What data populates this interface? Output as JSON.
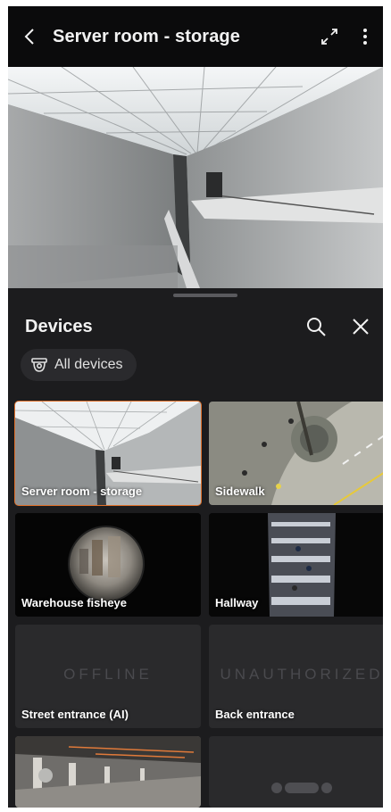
{
  "header": {
    "title": "Server room - storage"
  },
  "sheet": {
    "title": "Devices",
    "filter_chip": "All devices"
  },
  "devices": [
    {
      "name": "Server room - storage",
      "selected": true,
      "status": ""
    },
    {
      "name": "Sidewalk",
      "selected": false,
      "status": ""
    },
    {
      "name": "Warehouse fisheye",
      "selected": false,
      "status": ""
    },
    {
      "name": "Hallway",
      "selected": false,
      "status": ""
    },
    {
      "name": "Street entrance (AI)",
      "selected": false,
      "status": "OFFLINE"
    },
    {
      "name": "Back entrance",
      "selected": false,
      "status": "UNAUTHORIZED"
    }
  ],
  "colors": {
    "accent": "#e0702a",
    "background": "#1c1c1e",
    "appbar": "#0b0b0c"
  },
  "icons": {
    "back": "back-arrow-icon",
    "fullscreen": "fullscreen-icon",
    "more": "more-vert-icon",
    "search": "search-icon",
    "close": "close-icon",
    "camera": "camera-icon",
    "loading": "loading-dots-icon"
  }
}
